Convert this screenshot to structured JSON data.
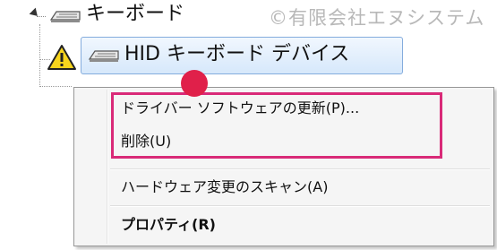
{
  "watermark": "©有限会社エヌシステム",
  "tree": {
    "category": {
      "label": "キーボード",
      "expander_icon": "triangle-expanded-icon",
      "icon": "keyboard-icon"
    },
    "device": {
      "label": "HID キーボード デバイス",
      "warning_icon": "warning-icon",
      "icon": "keyboard-icon",
      "selected": true
    }
  },
  "context_menu": {
    "items": [
      {
        "label": "ドライバー ソフトウェアの更新(P)...",
        "bold": false
      },
      {
        "label": "削除(U)",
        "bold": false
      },
      {
        "label": "ハードウェア変更のスキャン(A)",
        "bold": false
      },
      {
        "label": "プロパティ(R)",
        "bold": true
      }
    ]
  },
  "colors": {
    "highlight_border": "#d92a78",
    "cursor_marker": "#e0204a",
    "selection_border": "#84acdd",
    "warning_fill": "#f7d51d"
  }
}
